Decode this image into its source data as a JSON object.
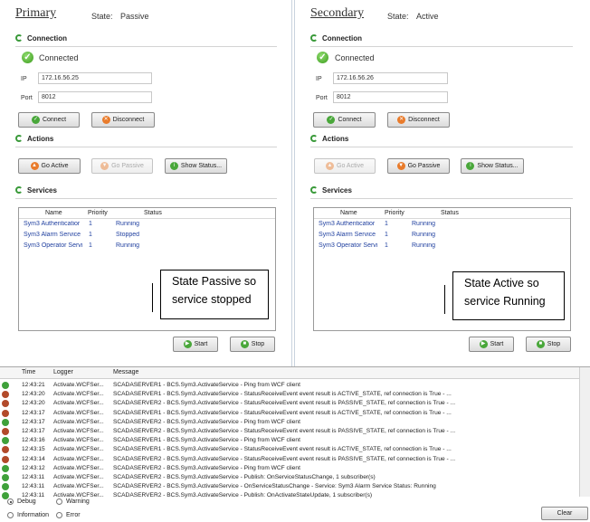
{
  "primary": {
    "title": "Primary",
    "state_label": "State:",
    "state_value": "Passive",
    "connection": {
      "heading": "Connection",
      "status": "Connected",
      "ip_label": "IP",
      "ip_value": "172.16.56.25",
      "port_label": "Port",
      "port_value": "8012",
      "connect_label": "Connect",
      "disconnect_label": "Disconnect"
    },
    "actions": {
      "heading": "Actions",
      "go_active": "Go Active",
      "go_passive": "Go Passive",
      "show_status": "Show Status..."
    },
    "services": {
      "heading": "Services",
      "columns": [
        "Name",
        "Priority",
        "Status"
      ],
      "rows": [
        {
          "name": "Sym3 Authenticatior",
          "priority": "1",
          "status": "Running"
        },
        {
          "name": "Sym3 Alarm Service",
          "priority": "1",
          "status": "Stopped"
        },
        {
          "name": "Sym3 Operator Servi",
          "priority": "1",
          "status": "Running"
        }
      ],
      "start": "Start",
      "stop": "Stop"
    },
    "callout": {
      "line1": "State Passive so",
      "line2": "service stopped"
    }
  },
  "secondary": {
    "title": "Secondary",
    "state_label": "State:",
    "state_value": "Active",
    "connection": {
      "heading": "Connection",
      "status": "Connected",
      "ip_label": "IP",
      "ip_value": "172.16.56.26",
      "port_label": "Port",
      "port_value": "8012",
      "connect_label": "Connect",
      "disconnect_label": "Disconnect"
    },
    "actions": {
      "heading": "Actions",
      "go_active": "Go Active",
      "go_passive": "Go Passive",
      "show_status": "Show Status..."
    },
    "services": {
      "heading": "Services",
      "columns": [
        "Name",
        "Priority",
        "Status"
      ],
      "rows": [
        {
          "name": "Sym3 Authenticatior",
          "priority": "1",
          "status": "Running"
        },
        {
          "name": "Sym3 Alarm Service",
          "priority": "1",
          "status": "Running"
        },
        {
          "name": "Sym3 Operator Servi",
          "priority": "1",
          "status": "Running"
        }
      ],
      "start": "Start",
      "stop": "Stop"
    },
    "callout": {
      "line1": "State Active so",
      "line2": "service Running"
    }
  },
  "log": {
    "columns": [
      "Time",
      "Logger",
      "Message"
    ],
    "rows": [
      {
        "level": "info",
        "time": "12:43:21",
        "logger": "Activate.WCFSer...",
        "message": "SCADASERVER1 - BCS.Sym3.ActivateService - Ping from WCF client"
      },
      {
        "level": "debug",
        "time": "12:43:20",
        "logger": "Activate.WCFSer...",
        "message": "SCADASERVER1 - BCS.Sym3.ActivateService - StatusReceiveEvent event result is ACTIVE_STATE, ref connection is True - ..."
      },
      {
        "level": "debug",
        "time": "12:43:20",
        "logger": "Activate.WCFSer...",
        "message": "SCADASERVER2 - BCS.Sym3.ActivateService - StatusReceiveEvent event result is PASSIVE_STATE, ref connection is True - ..."
      },
      {
        "level": "debug",
        "time": "12:43:17",
        "logger": "Activate.WCFSer...",
        "message": "SCADASERVER1 - BCS.Sym3.ActivateService - StatusReceiveEvent event result is ACTIVE_STATE, ref connection is True - ..."
      },
      {
        "level": "info",
        "time": "12:43:17",
        "logger": "Activate.WCFSer...",
        "message": "SCADASERVER2 - BCS.Sym3.ActivateService - Ping from WCF client"
      },
      {
        "level": "debug",
        "time": "12:43:17",
        "logger": "Activate.WCFSer...",
        "message": "SCADASERVER2 - BCS.Sym3.ActivateService - StatusReceiveEvent event result is PASSIVE_STATE, ref connection is True - ..."
      },
      {
        "level": "info",
        "time": "12:43:16",
        "logger": "Activate.WCFSer...",
        "message": "SCADASERVER1 - BCS.Sym3.ActivateService - Ping from WCF client"
      },
      {
        "level": "debug",
        "time": "12:43:15",
        "logger": "Activate.WCFSer...",
        "message": "SCADASERVER1 - BCS.Sym3.ActivateService - StatusReceiveEvent event result is ACTIVE_STATE, ref connection is True - ..."
      },
      {
        "level": "debug",
        "time": "12:43:14",
        "logger": "Activate.WCFSer...",
        "message": "SCADASERVER2 - BCS.Sym3.ActivateService - StatusReceiveEvent event result is PASSIVE_STATE, ref connection is True - ..."
      },
      {
        "level": "info",
        "time": "12:43:12",
        "logger": "Activate.WCFSer...",
        "message": "SCADASERVER2 - BCS.Sym3.ActivateService - Ping from WCF client"
      },
      {
        "level": "info",
        "time": "12:43:11",
        "logger": "Activate.WCFSer...",
        "message": "SCADASERVER2 - BCS.Sym3.ActivateService - Publish: OnServiceStatusChange, 1 subscriber(s)"
      },
      {
        "level": "info",
        "time": "12:43:11",
        "logger": "Activate.WCFSer...",
        "message": "SCADASERVER2 - BCS.Sym3.ActivateService - OnServiceStatusChange - Service: Sym3 Alarm Service Status: Running"
      },
      {
        "level": "info",
        "time": "12:43:11",
        "logger": "Activate.WCFSer...",
        "message": "SCADASERVER2 - BCS.Sym3.ActivateService - Publish: OnActivateStateUpdate, 1 subscriber(s)"
      }
    ],
    "filters": {
      "debug": "Debug",
      "warning": "Warning",
      "information": "Information",
      "error": "Error"
    },
    "clear": "Clear"
  },
  "colors": {
    "accent_green": "#3c9c1e",
    "link_blue": "#1f3f9f",
    "debug_icon": "#b24a2a"
  }
}
